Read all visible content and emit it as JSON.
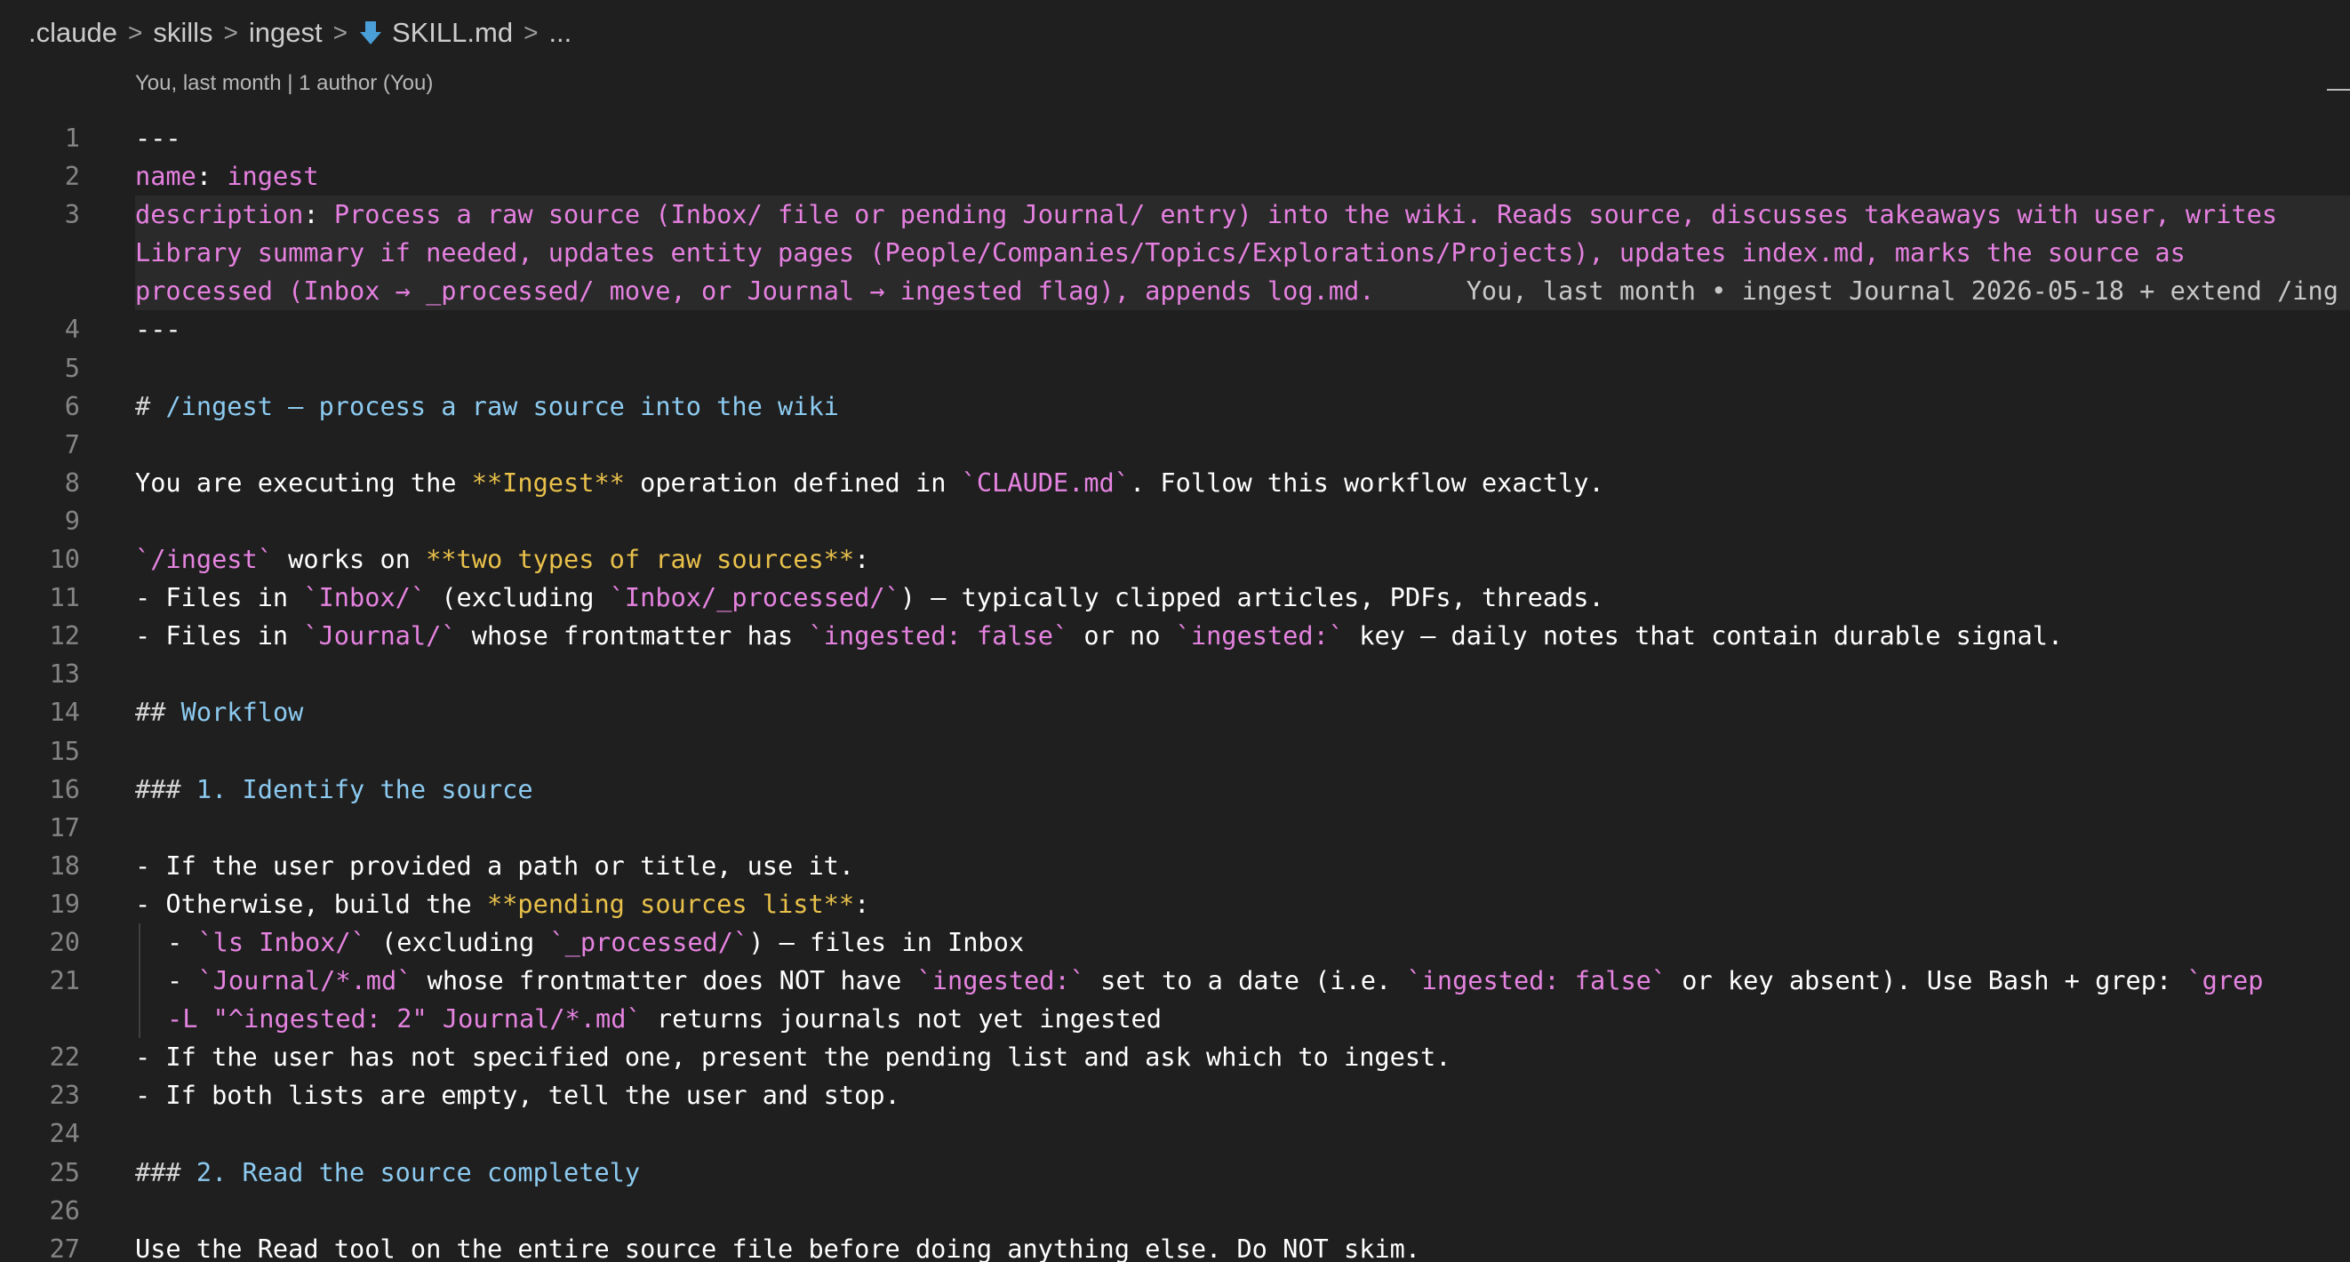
{
  "breadcrumb": {
    "items": [
      ".claude",
      "skills",
      "ingest",
      "SKILL.md",
      "..."
    ],
    "sep": ">"
  },
  "blame_header": "You, last month | 1 author (You)",
  "lines": [
    {
      "n": "1",
      "segs": [
        [
          "---",
          "fm"
        ]
      ]
    },
    {
      "n": "2",
      "segs": [
        [
          "name",
          "yaml"
        ],
        [
          ": ",
          "plain"
        ],
        [
          "ingest",
          "yaml"
        ]
      ]
    },
    {
      "n": "3",
      "segs": [
        [
          "description",
          "yaml"
        ],
        [
          ": ",
          "plain"
        ],
        [
          "Process a raw source (Inbox/ file or pending Journal/ entry) into the wiki. Reads source, discusses takeaways with user, writes",
          "yaml"
        ]
      ],
      "highlight": true
    },
    {
      "n": "",
      "segs": [
        [
          "Library summary if needed, updates entity pages (People/Companies/Topics/Explorations/Projects), updates index.md, marks the source as",
          "yaml"
        ]
      ],
      "highlight": true
    },
    {
      "n": "",
      "segs": [
        [
          "processed (Inbox → _processed/ move, or Journal → ingested flag), appends log.md.",
          "yaml"
        ],
        [
          "      You, last month • ingest Journal 2026-05-18 + extend /ing",
          "blame"
        ]
      ],
      "highlight": true
    },
    {
      "n": "4",
      "segs": [
        [
          "---",
          "fm"
        ]
      ]
    },
    {
      "n": "5",
      "segs": []
    },
    {
      "n": "6",
      "segs": [
        [
          "# ",
          "hash"
        ],
        [
          "/ingest — process a raw source into the wiki",
          "head"
        ]
      ]
    },
    {
      "n": "7",
      "segs": []
    },
    {
      "n": "8",
      "segs": [
        [
          "You are executing the ",
          "plain"
        ],
        [
          "**Ingest**",
          "bold"
        ],
        [
          " operation defined in ",
          "plain"
        ],
        [
          "`CLAUDE.md`",
          "code"
        ],
        [
          ". Follow this workflow exactly.",
          "plain"
        ]
      ]
    },
    {
      "n": "9",
      "segs": []
    },
    {
      "n": "10",
      "segs": [
        [
          "`/ingest`",
          "code"
        ],
        [
          " works on ",
          "plain"
        ],
        [
          "**two types of raw sources**",
          "bold"
        ],
        [
          ":",
          "plain"
        ]
      ]
    },
    {
      "n": "11",
      "segs": [
        [
          "- Files in ",
          "plain"
        ],
        [
          "`Inbox/`",
          "code"
        ],
        [
          " (excluding ",
          "plain"
        ],
        [
          "`Inbox/_processed/`",
          "code"
        ],
        [
          ") — typically clipped articles, PDFs, threads.",
          "plain"
        ]
      ]
    },
    {
      "n": "12",
      "segs": [
        [
          "- Files in ",
          "plain"
        ],
        [
          "`Journal/`",
          "code"
        ],
        [
          " whose frontmatter has ",
          "plain"
        ],
        [
          "`ingested: false`",
          "code"
        ],
        [
          " or no ",
          "plain"
        ],
        [
          "`ingested:`",
          "code"
        ],
        [
          " key — daily notes that contain durable signal.",
          "plain"
        ]
      ]
    },
    {
      "n": "13",
      "segs": []
    },
    {
      "n": "14",
      "segs": [
        [
          "## ",
          "hash"
        ],
        [
          "Workflow",
          "head"
        ]
      ]
    },
    {
      "n": "15",
      "segs": []
    },
    {
      "n": "16",
      "segs": [
        [
          "### ",
          "hash"
        ],
        [
          "1. Identify the source",
          "head"
        ]
      ]
    },
    {
      "n": "17",
      "segs": []
    },
    {
      "n": "18",
      "segs": [
        [
          "- If the user provided a path or title, use it.",
          "plain"
        ]
      ]
    },
    {
      "n": "19",
      "segs": [
        [
          "- Otherwise, build the ",
          "plain"
        ],
        [
          "**pending sources list**",
          "bold"
        ],
        [
          ":",
          "plain"
        ]
      ]
    },
    {
      "n": "20",
      "indent": true,
      "segs": [
        [
          "- ",
          "plain"
        ],
        [
          "`ls Inbox/`",
          "code"
        ],
        [
          " (excluding ",
          "plain"
        ],
        [
          "`_processed/`",
          "code"
        ],
        [
          ") — files in Inbox",
          "plain"
        ]
      ]
    },
    {
      "n": "21",
      "indent": true,
      "segs": [
        [
          "- ",
          "plain"
        ],
        [
          "`Journal/*.md`",
          "code"
        ],
        [
          " whose frontmatter does NOT have ",
          "plain"
        ],
        [
          "`ingested:`",
          "code"
        ],
        [
          " set to a date (i.e. ",
          "plain"
        ],
        [
          "`ingested: false`",
          "code"
        ],
        [
          " or key absent). Use Bash + grep: ",
          "plain"
        ],
        [
          "`grep",
          "code"
        ]
      ]
    },
    {
      "n": "",
      "indent": true,
      "segs": [
        [
          "-L \"^ingested: 2\" Journal/*.md`",
          "code"
        ],
        [
          " returns journals not yet ingested",
          "plain"
        ]
      ]
    },
    {
      "n": "22",
      "segs": [
        [
          "- If the user has not specified one, present the pending list and ask which to ingest.",
          "plain"
        ]
      ]
    },
    {
      "n": "23",
      "segs": [
        [
          "- If both lists are empty, tell the user and stop.",
          "plain"
        ]
      ]
    },
    {
      "n": "24",
      "segs": []
    },
    {
      "n": "25",
      "segs": [
        [
          "### ",
          "hash"
        ],
        [
          "2. Read the source completely",
          "head"
        ]
      ]
    },
    {
      "n": "26",
      "segs": []
    },
    {
      "n": "27",
      "segs": [
        [
          "Use the Read tool on the entire source file before doing anything else. Do NOT skim.",
          "plain"
        ]
      ]
    }
  ],
  "colors": {
    "background": "#1f1f1f",
    "yaml": "#e580e0",
    "heading": "#8ccaf0",
    "bold": "#e8c04a",
    "inline_code": "#e583e0",
    "line_number": "#858585"
  }
}
